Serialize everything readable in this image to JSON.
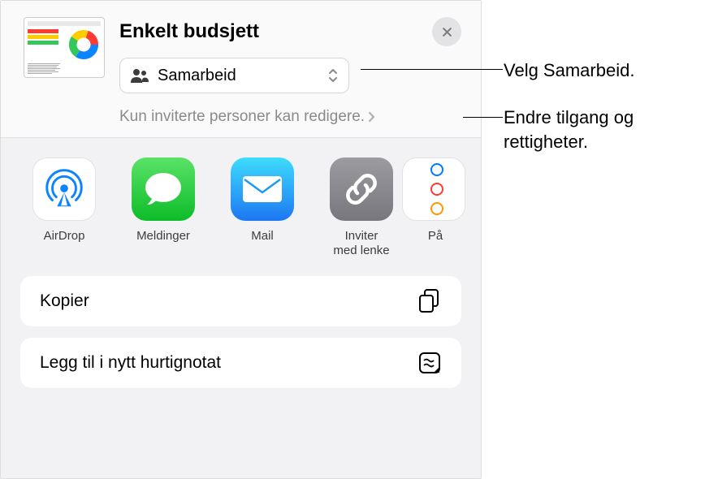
{
  "document": {
    "title": "Enkelt budsjett"
  },
  "collaboration": {
    "mode_label": "Samarbeid",
    "permissions_text": "Kun inviterte personer kan redigere."
  },
  "share_targets": [
    {
      "label": "AirDrop",
      "icon": "airdrop"
    },
    {
      "label": "Meldinger",
      "icon": "messages"
    },
    {
      "label": "Mail",
      "icon": "mail"
    },
    {
      "label": "Inviter\nmed lenke",
      "icon": "link"
    },
    {
      "label": "På",
      "icon": "reminders"
    }
  ],
  "actions": {
    "copy_label": "Kopier",
    "quicknote_label": "Legg til i nytt hurtignotat"
  },
  "annotations": {
    "callout_collab": "Velg Samarbeid.",
    "callout_permissions": "Endre tilgang og rettigheter."
  }
}
